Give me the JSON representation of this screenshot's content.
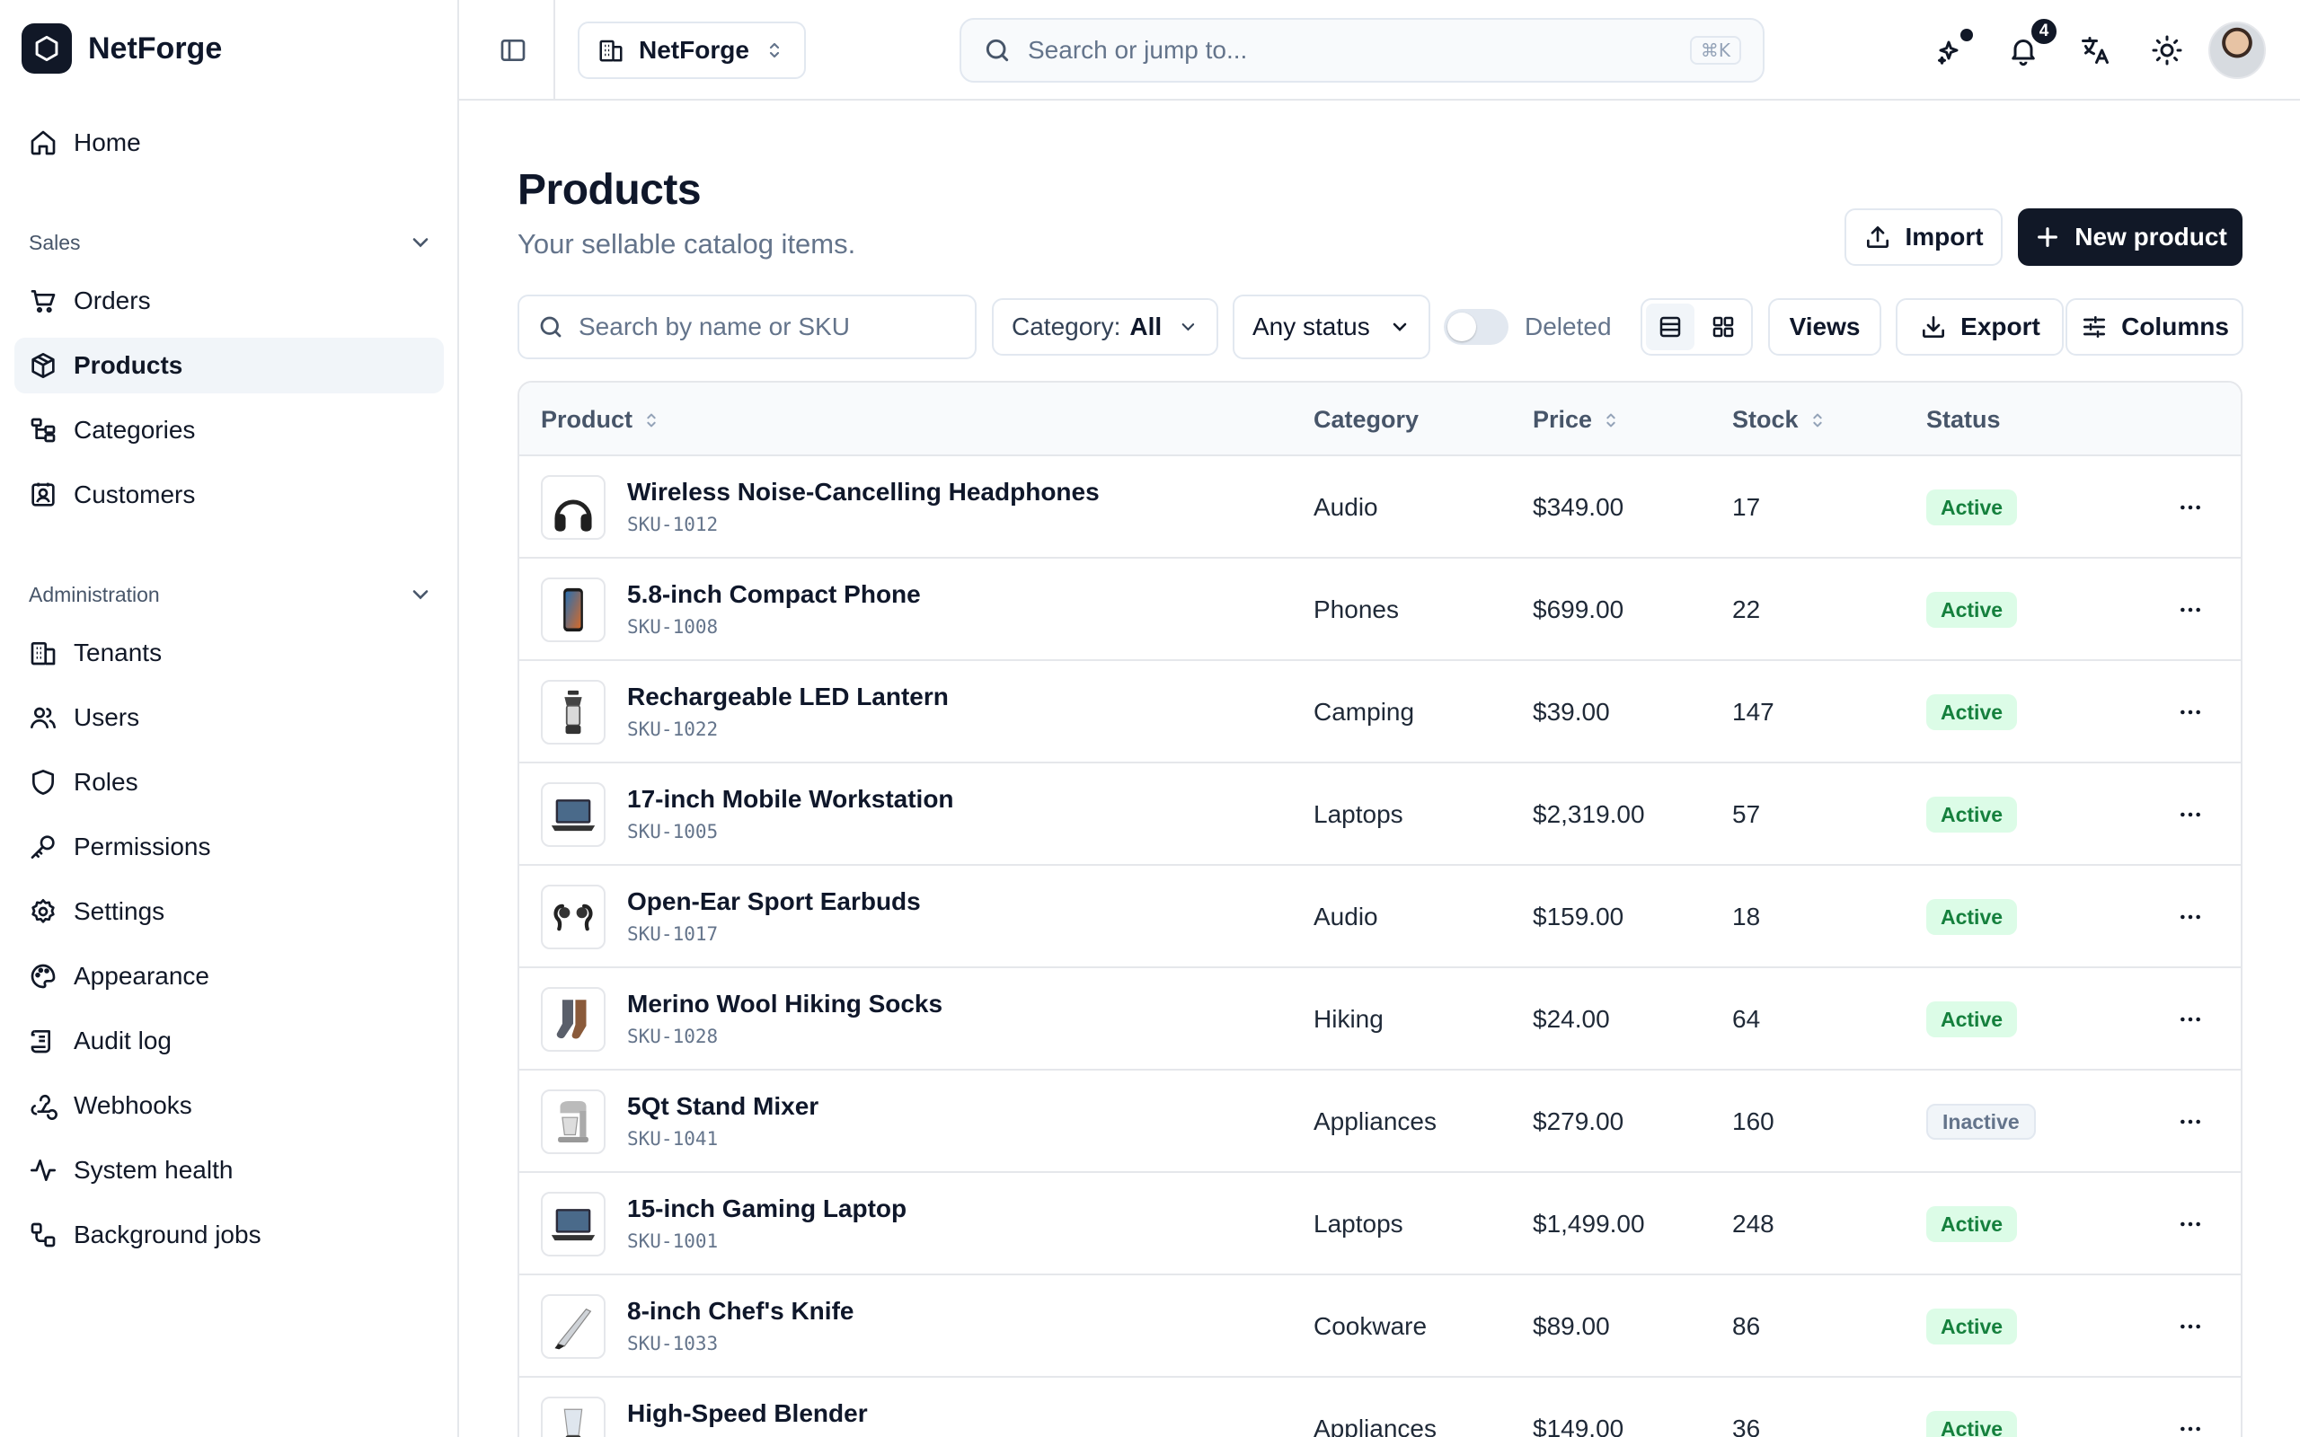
{
  "brand": {
    "name": "NetForge"
  },
  "sidebar": {
    "home": "Home",
    "sales": {
      "title": "Sales",
      "items": [
        "Orders",
        "Products",
        "Categories",
        "Customers"
      ]
    },
    "admin": {
      "title": "Administration",
      "items": [
        "Tenants",
        "Users",
        "Roles",
        "Permissions",
        "Settings",
        "Appearance",
        "Audit log",
        "Webhooks",
        "System health",
        "Background jobs"
      ]
    },
    "active_item": "Products"
  },
  "topbar": {
    "tenant": "NetForge",
    "search_placeholder": "Search or jump to...",
    "search_shortcut": "⌘K",
    "notifications_count": "4"
  },
  "page": {
    "title": "Products",
    "subtitle": "Your sellable catalog items.",
    "import_label": "Import",
    "new_label": "New product"
  },
  "filters": {
    "search_placeholder": "Search by name or SKU",
    "category_label": "Category:",
    "category_value": "All",
    "status_value": "Any status",
    "deleted_label": "Deleted",
    "views_label": "Views",
    "export_label": "Export",
    "columns_label": "Columns"
  },
  "table": {
    "headers": {
      "product": "Product",
      "category": "Category",
      "price": "Price",
      "stock": "Stock",
      "status": "Status"
    },
    "rows": [
      {
        "name": "Wireless Noise-Cancelling Headphones",
        "sku": "SKU-1012",
        "category": "Audio",
        "price": "$349.00",
        "stock": "17",
        "status": "Active",
        "icon": "headphones"
      },
      {
        "name": "5.8-inch Compact Phone",
        "sku": "SKU-1008",
        "category": "Phones",
        "price": "$699.00",
        "stock": "22",
        "status": "Active",
        "icon": "phone"
      },
      {
        "name": "Rechargeable LED Lantern",
        "sku": "SKU-1022",
        "category": "Camping",
        "price": "$39.00",
        "stock": "147",
        "status": "Active",
        "icon": "lantern"
      },
      {
        "name": "17-inch Mobile Workstation",
        "sku": "SKU-1005",
        "category": "Laptops",
        "price": "$2,319.00",
        "stock": "57",
        "status": "Active",
        "icon": "laptop"
      },
      {
        "name": "Open-Ear Sport Earbuds",
        "sku": "SKU-1017",
        "category": "Audio",
        "price": "$159.00",
        "stock": "18",
        "status": "Active",
        "icon": "earbuds"
      },
      {
        "name": "Merino Wool Hiking Socks",
        "sku": "SKU-1028",
        "category": "Hiking",
        "price": "$24.00",
        "stock": "64",
        "status": "Active",
        "icon": "socks"
      },
      {
        "name": "5Qt Stand Mixer",
        "sku": "SKU-1041",
        "category": "Appliances",
        "price": "$279.00",
        "stock": "160",
        "status": "Inactive",
        "icon": "mixer"
      },
      {
        "name": "15-inch Gaming Laptop",
        "sku": "SKU-1001",
        "category": "Laptops",
        "price": "$1,499.00",
        "stock": "248",
        "status": "Active",
        "icon": "laptop"
      },
      {
        "name": "8-inch Chef's Knife",
        "sku": "SKU-1033",
        "category": "Cookware",
        "price": "$89.00",
        "stock": "86",
        "status": "Active",
        "icon": "knife"
      },
      {
        "name": "High-Speed Blender",
        "sku": "",
        "category": "Appliances",
        "price": "$149.00",
        "stock": "36",
        "status": "Active",
        "icon": "blender"
      }
    ]
  },
  "colors": {
    "primary": "#111827",
    "active_bg": "#dcfce7",
    "active_text": "#15803d",
    "border": "#e5e7eb"
  }
}
